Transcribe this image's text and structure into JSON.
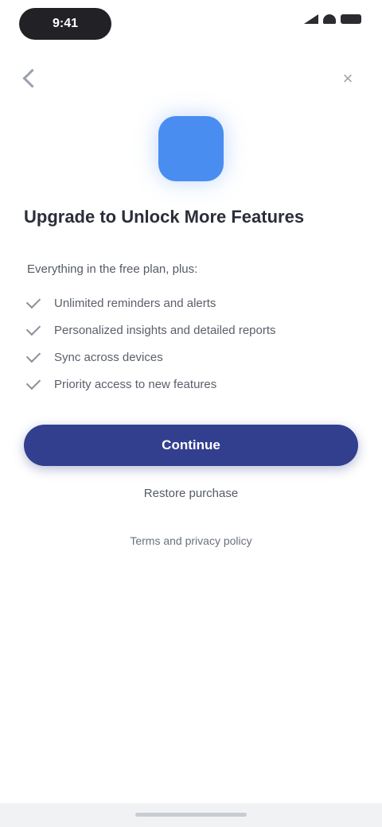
{
  "status_bar": {
    "time": "9:41",
    "battery": ""
  },
  "header": {
    "back_label": "",
    "close_label": "×"
  },
  "content": {
    "headline": "Upgrade to Unlock More Features",
    "intro": "Everything in the free plan, plus:",
    "permissions": [
      "Unlimited reminders and alerts",
      "Personalized insights and detailed reports",
      "Sync across devices",
      "Priority access to new features"
    ]
  },
  "actions": {
    "primary_label": "Continue",
    "secondary_label": "Restore purchase",
    "tertiary_label": "Terms and privacy policy"
  },
  "colors": {
    "accent": "#323f8f",
    "app_icon": "#4a8df0"
  }
}
